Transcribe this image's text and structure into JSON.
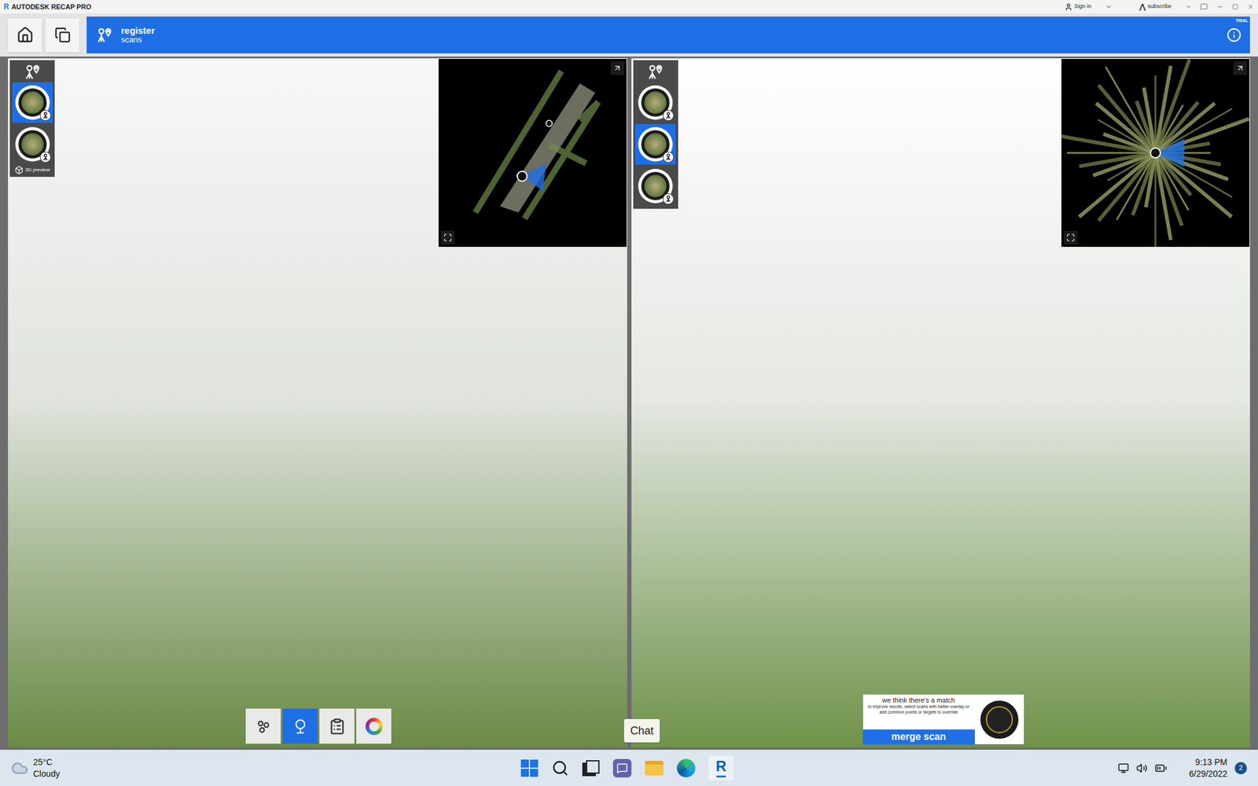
{
  "window": {
    "logo": "R",
    "title": "AUTODESK RECAP PRO",
    "sign_in": "Sign in",
    "subscribe": "subscribe"
  },
  "header": {
    "title": "register",
    "subtitle": "scans",
    "badge": "TRIAL"
  },
  "left_panel": {
    "scans": [
      {
        "selected": true
      },
      {
        "selected": false
      }
    ],
    "preview_label": "3D preview"
  },
  "right_panel": {
    "scans": [
      {
        "selected": false
      },
      {
        "selected": true
      },
      {
        "selected": false
      }
    ]
  },
  "tools": [
    {
      "kind": "targets",
      "selected": false
    },
    {
      "kind": "view",
      "selected": true
    },
    {
      "kind": "report",
      "selected": false
    },
    {
      "kind": "color",
      "selected": false
    }
  ],
  "tooltip": "Chat",
  "match": {
    "title": "we think there's a match",
    "hint": "to improve results, select scans with better overlap or add common points or targets to override",
    "button": "merge scan"
  },
  "taskbar": {
    "temperature": "25°C",
    "weather": "Cloudy",
    "app_logo": "R",
    "time": "9:13 PM",
    "date": "6/29/2022",
    "notifications": "2"
  }
}
